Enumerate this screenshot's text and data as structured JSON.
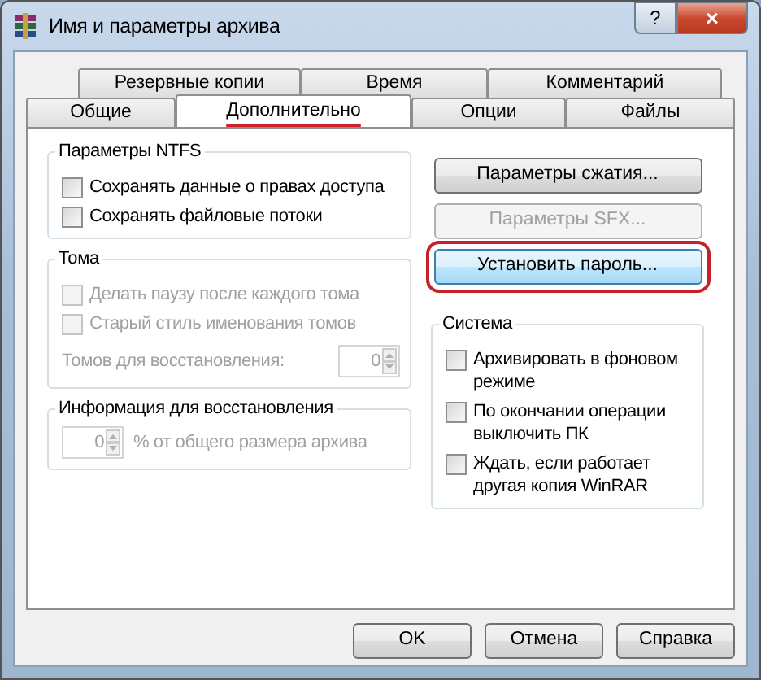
{
  "window": {
    "title": "Имя и параметры архива",
    "help": "?",
    "close": "×"
  },
  "tab_rows": [
    [
      {
        "label": "Резервные копии",
        "selected": false
      },
      {
        "label": "Время",
        "selected": false
      },
      {
        "label": "Комментарий",
        "selected": false
      }
    ],
    [
      {
        "label": "Общие",
        "selected": false
      },
      {
        "label": "Дополнительно",
        "selected": true,
        "annotated": true
      },
      {
        "label": "Опции",
        "selected": false
      },
      {
        "label": "Файлы",
        "selected": false
      }
    ]
  ],
  "ntfs": {
    "title": "Параметры NTFS",
    "items": [
      {
        "label": "Сохранять данные о правах доступа",
        "checked": false,
        "disabled": false
      },
      {
        "label": "Сохранять файловые потоки",
        "checked": false,
        "disabled": false
      }
    ]
  },
  "volumes": {
    "title": "Тома",
    "items": [
      {
        "label": "Делать паузу после каждого тома",
        "checked": false,
        "disabled": true
      },
      {
        "label": "Старый стиль именования томов",
        "checked": false,
        "disabled": true
      }
    ],
    "recovery_volumes": {
      "label": "Томов для восстановления:",
      "value": "0",
      "disabled": true
    }
  },
  "recovery": {
    "title": "Информация для восстановления",
    "value": "0",
    "suffix": "% от общего размера архива",
    "disabled": true
  },
  "buttons": [
    {
      "label": "Параметры сжатия...",
      "disabled": false,
      "annotated": false
    },
    {
      "label": "Параметры SFX...",
      "disabled": true,
      "annotated": false
    },
    {
      "label": "Установить пароль...",
      "disabled": false,
      "annotated": true
    }
  ],
  "system": {
    "title": "Система",
    "items": [
      {
        "label": "Архивировать в фоновом режиме",
        "checked": false,
        "disabled": false
      },
      {
        "label": "По окончании операции выключить ПК",
        "checked": false,
        "disabled": false
      },
      {
        "label": "Ждать, если работает другая копия WinRAR",
        "checked": false,
        "disabled": false
      }
    ]
  },
  "dialog_buttons": [
    "OK",
    "Отмена",
    "Справка"
  ]
}
